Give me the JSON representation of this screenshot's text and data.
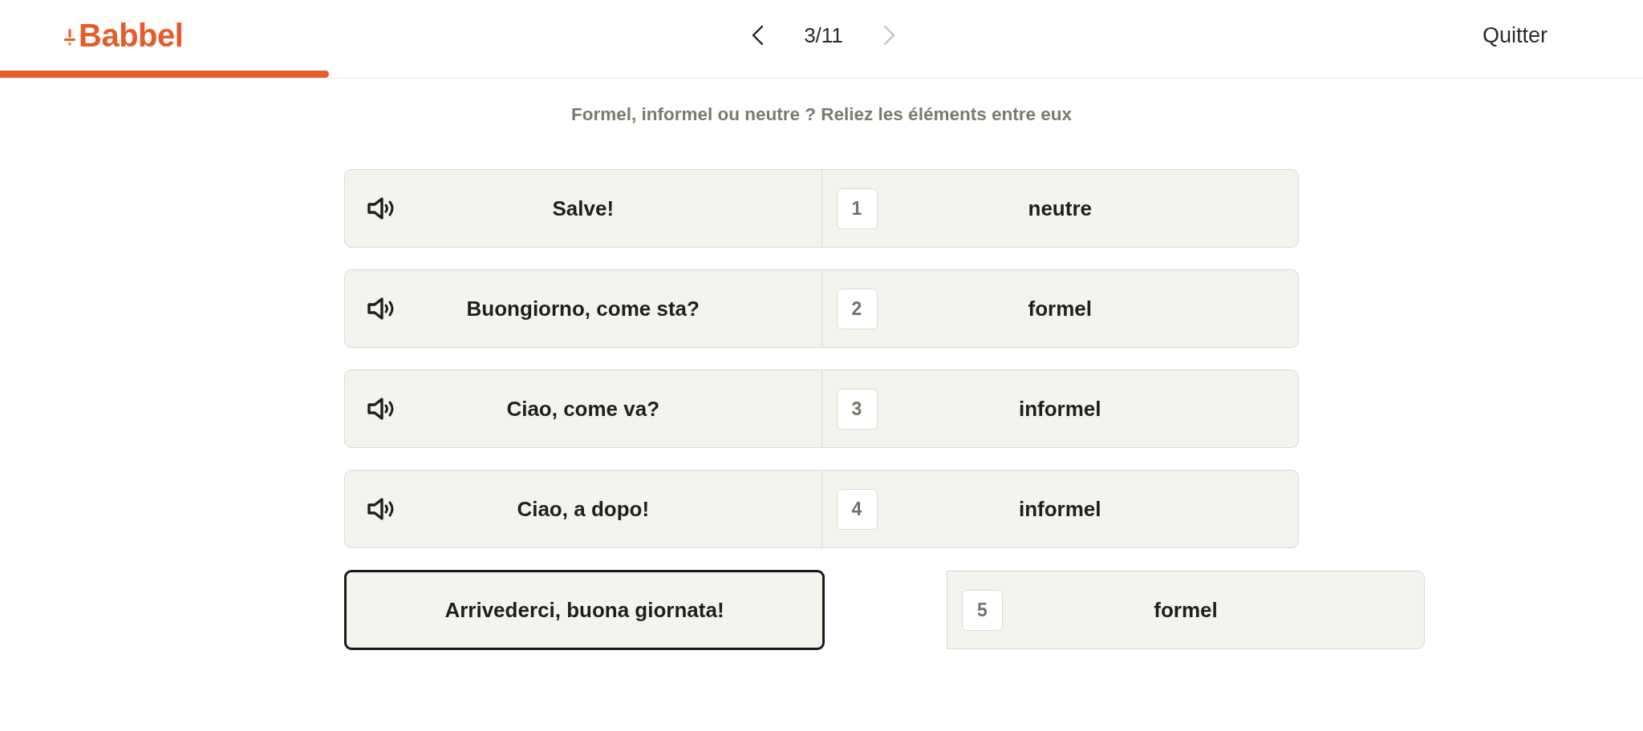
{
  "header": {
    "logo": "Babbel",
    "progress": {
      "level": 0.2
    },
    "nav": {
      "counter": "3/11",
      "prev_disabled": false,
      "next_disabled": true
    },
    "quit": "Quitter"
  },
  "instruction": "Formel, informel ou neutre ? Reliez les éléments entre eux",
  "pairs": [
    {
      "phrase": "Salve!",
      "audio": true,
      "number": "1",
      "answer": "neutre"
    },
    {
      "phrase": "Buongiorno, come sta?",
      "audio": true,
      "number": "2",
      "answer": "formel"
    },
    {
      "phrase": "Ciao, come va?",
      "audio": true,
      "number": "3",
      "answer": "informel"
    },
    {
      "phrase": "Ciao, a dopo!",
      "audio": true,
      "number": "4",
      "answer": "informel"
    }
  ],
  "unpaired": {
    "phrase": {
      "text": "Arrivederci, buona giornata!",
      "audio": false,
      "selected": true
    },
    "answer": {
      "number": "5",
      "text": "formel",
      "selected": false
    }
  }
}
